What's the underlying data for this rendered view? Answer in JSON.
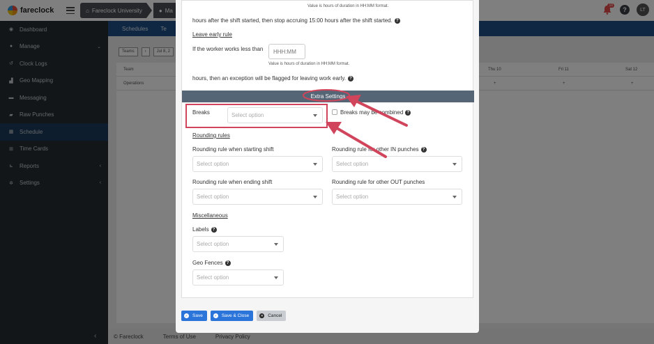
{
  "brand": {
    "name": "fareclock"
  },
  "breadcrumbs": [
    {
      "label": "Fareclock University",
      "icon": "home-icon"
    },
    {
      "label": "Ma",
      "icon": "user-icon"
    }
  ],
  "topbar": {
    "notification_count": "10",
    "help": "?",
    "avatar_initials": "LT"
  },
  "sidebar": {
    "items": [
      {
        "label": "Dashboard",
        "icon": "dashboard-icon"
      },
      {
        "label": "Manage",
        "icon": "user-icon",
        "has_chevron": true
      },
      {
        "label": "Clock Logs",
        "icon": "clock-icon"
      },
      {
        "label": "Geo Mapping",
        "icon": "map-icon"
      },
      {
        "label": "Messaging",
        "icon": "chat-icon"
      },
      {
        "label": "Raw Punches",
        "icon": "punch-icon"
      },
      {
        "label": "Schedule",
        "icon": "calendar-icon",
        "active": true
      },
      {
        "label": "Time Cards",
        "icon": "table-icon"
      },
      {
        "label": "Reports",
        "icon": "chart-icon",
        "has_chevron": true
      },
      {
        "label": "Settings",
        "icon": "gear-icon",
        "has_chevron": true
      }
    ]
  },
  "page": {
    "tabs": [
      "Schedules",
      "Te"
    ],
    "toolbar": {
      "teams": "Teams",
      "date": "Jul 8, 2"
    },
    "schedule_head": {
      "team": "Team",
      "thu": "Thu 10",
      "fri": "Fri 11",
      "sat": "Sat 12"
    },
    "schedule_row": {
      "team": "Operations",
      "plus": "+"
    },
    "footer": {
      "copyright": "© Fareclock",
      "terms": "Terms of Use",
      "privacy": "Privacy Policy"
    }
  },
  "modal": {
    "duration_hint": "Value is hours of duration in HH:MM format.",
    "after_shift_text": "hours after the shift started, then stop accruing 15:00 hours after the shift started.",
    "leave_early_heading": "Leave early rule",
    "leave_early_prefix": "If the worker works less than",
    "hhmm_placeholder": "HHH:MM",
    "leave_early_suffix": "hours, then an exception will be flagged for leaving work early.",
    "extra_settings_title": "Extra Settings",
    "breaks_label": "Breaks",
    "breaks_combined_label": "Breaks may be combined",
    "select_placeholder": "Select option",
    "rounding_heading": "Rounding rules",
    "rounding_start_label": "Rounding rule when starting shift",
    "rounding_other_in_label": "Rounding rule for other IN punches",
    "rounding_end_label": "Rounding rule when ending shift",
    "rounding_other_out_label": "Rounding rule for other OUT punches",
    "misc_heading": "Miscellaneous",
    "labels_label": "Labels",
    "geofences_label": "Geo Fences",
    "buttons": {
      "save": "Save",
      "save_close": "Save & Close",
      "cancel": "Cancel"
    }
  },
  "colors": {
    "sidebar_bg": "#262c33",
    "header_blue": "#1f4f86",
    "section_bar": "#566575",
    "primary_button": "#2b74d9",
    "annotation_red": "#d0455b"
  }
}
